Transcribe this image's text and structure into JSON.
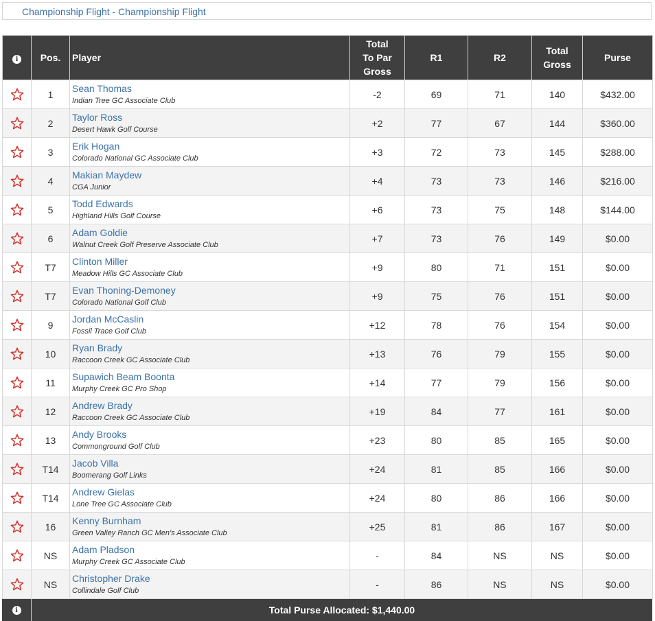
{
  "flight_title": "Championship Flight - Championship Flight",
  "headers": {
    "info": "i",
    "pos": "Pos.",
    "player": "Player",
    "to_par_l1": "Total",
    "to_par_l2": "To Par",
    "to_par_l3": "Gross",
    "r1": "R1",
    "r2": "R2",
    "total_l1": "Total",
    "total_l2": "Gross",
    "purse": "Purse"
  },
  "colors": {
    "header_bg": "#3f3f3f",
    "link": "#3c72a8",
    "star": "#d22f27",
    "alt_row": "#f3f3f3"
  },
  "icons": {
    "favorite": "star-outline-icon",
    "info": "info-circle-icon"
  },
  "rows": [
    {
      "pos": "1",
      "name": "Sean Thomas",
      "club": "Indian Tree GC Associate Club",
      "to_par": "-2",
      "r1": "69",
      "r2": "71",
      "total": "140",
      "purse": "$432.00"
    },
    {
      "pos": "2",
      "name": "Taylor Ross",
      "club": "Desert Hawk Golf Course",
      "to_par": "+2",
      "r1": "77",
      "r2": "67",
      "total": "144",
      "purse": "$360.00"
    },
    {
      "pos": "3",
      "name": "Erik Hogan",
      "club": "Colorado National GC Associate Club",
      "to_par": "+3",
      "r1": "72",
      "r2": "73",
      "total": "145",
      "purse": "$288.00"
    },
    {
      "pos": "4",
      "name": "Makian Maydew",
      "club": "CGA Junior",
      "to_par": "+4",
      "r1": "73",
      "r2": "73",
      "total": "146",
      "purse": "$216.00"
    },
    {
      "pos": "5",
      "name": "Todd Edwards",
      "club": "Highland Hills Golf Course",
      "to_par": "+6",
      "r1": "73",
      "r2": "75",
      "total": "148",
      "purse": "$144.00"
    },
    {
      "pos": "6",
      "name": "Adam Goldie",
      "club": "Walnut Creek Golf Preserve Associate Club",
      "to_par": "+7",
      "r1": "73",
      "r2": "76",
      "total": "149",
      "purse": "$0.00"
    },
    {
      "pos": "T7",
      "name": "Clinton Miller",
      "club": "Meadow Hills GC Associate Club",
      "to_par": "+9",
      "r1": "80",
      "r2": "71",
      "total": "151",
      "purse": "$0.00"
    },
    {
      "pos": "T7",
      "name": "Evan Thoning-Demoney",
      "club": "Colorado National Golf Club",
      "to_par": "+9",
      "r1": "75",
      "r2": "76",
      "total": "151",
      "purse": "$0.00"
    },
    {
      "pos": "9",
      "name": "Jordan McCaslin",
      "club": "Fossil Trace Golf Club",
      "to_par": "+12",
      "r1": "78",
      "r2": "76",
      "total": "154",
      "purse": "$0.00"
    },
    {
      "pos": "10",
      "name": "Ryan Brady",
      "club": "Raccoon Creek GC Associate Club",
      "to_par": "+13",
      "r1": "76",
      "r2": "79",
      "total": "155",
      "purse": "$0.00"
    },
    {
      "pos": "11",
      "name": "Supawich Beam Boonta",
      "club": "Murphy Creek GC Pro Shop",
      "to_par": "+14",
      "r1": "77",
      "r2": "79",
      "total": "156",
      "purse": "$0.00"
    },
    {
      "pos": "12",
      "name": "Andrew Brady",
      "club": "Raccoon Creek GC Associate Club",
      "to_par": "+19",
      "r1": "84",
      "r2": "77",
      "total": "161",
      "purse": "$0.00"
    },
    {
      "pos": "13",
      "name": "Andy Brooks",
      "club": "Commonground Golf Club",
      "to_par": "+23",
      "r1": "80",
      "r2": "85",
      "total": "165",
      "purse": "$0.00"
    },
    {
      "pos": "T14",
      "name": "Jacob Villa",
      "club": "Boomerang Golf Links",
      "to_par": "+24",
      "r1": "81",
      "r2": "85",
      "total": "166",
      "purse": "$0.00"
    },
    {
      "pos": "T14",
      "name": "Andrew Gielas",
      "club": "Lone Tree GC Associate Club",
      "to_par": "+24",
      "r1": "80",
      "r2": "86",
      "total": "166",
      "purse": "$0.00"
    },
    {
      "pos": "16",
      "name": "Kenny Burnham",
      "club": "Green Valley Ranch GC Men's Associate Club",
      "to_par": "+25",
      "r1": "81",
      "r2": "86",
      "total": "167",
      "purse": "$0.00"
    },
    {
      "pos": "NS",
      "name": "Adam Pladson",
      "club": "Murphy Creek GC Associate Club",
      "to_par": "-",
      "r1": "84",
      "r2": "NS",
      "total": "NS",
      "purse": "$0.00"
    },
    {
      "pos": "NS",
      "name": "Christopher Drake",
      "club": "Collindale Golf Club",
      "to_par": "-",
      "r1": "86",
      "r2": "NS",
      "total": "NS",
      "purse": "$0.00"
    }
  ],
  "footer": {
    "info": "i",
    "total_purse": "Total Purse Allocated: $1,440.00"
  }
}
